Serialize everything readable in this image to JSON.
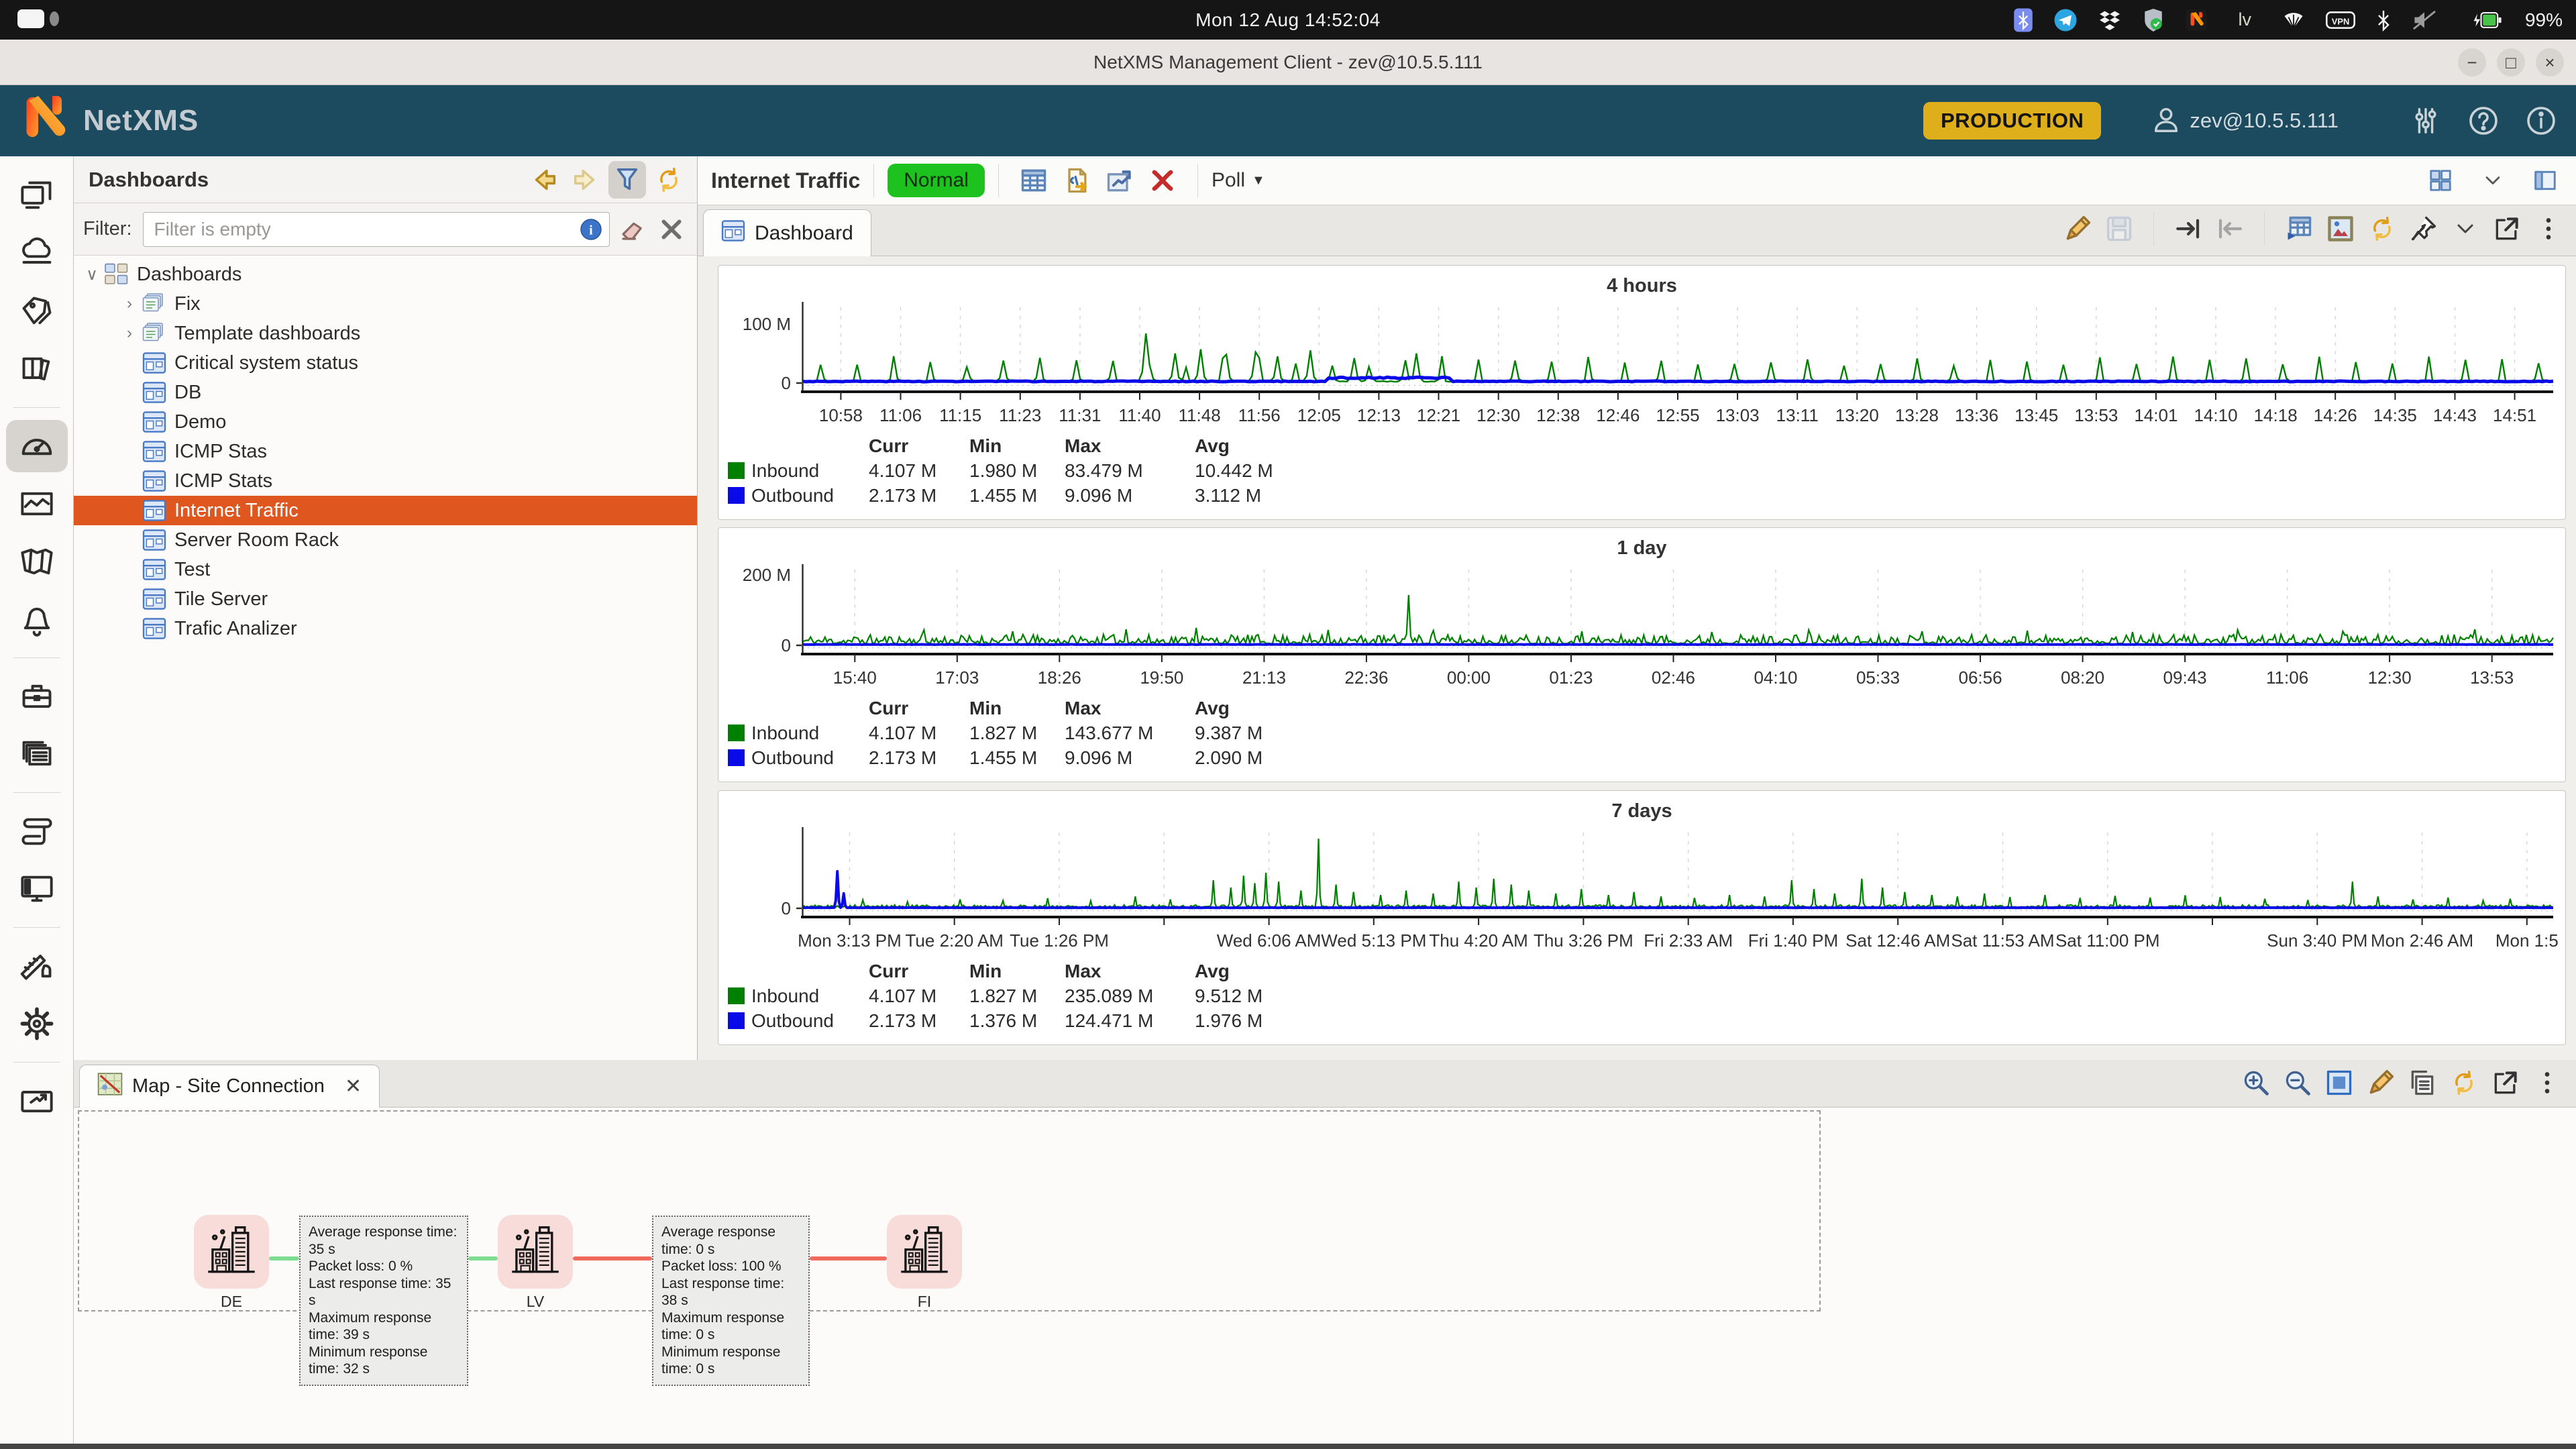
{
  "topbar": {
    "clock": "Mon 12 Aug 14:52:04",
    "keyboard_layout": "lv",
    "battery_pct": "99%",
    "tray_left_icons": [
      "bluetooth-app-icon",
      "telegram-icon",
      "dropbox-icon",
      "shield-check-icon",
      "netxms-tray-icon"
    ],
    "tray_right_icons": [
      "wifi-icon",
      "vpn-icon",
      "bluetooth-icon",
      "audio-muted-icon"
    ]
  },
  "window": {
    "title": "NetXMS Management Client - zev@10.5.5.111",
    "controls": [
      "minimize",
      "maximize",
      "close"
    ]
  },
  "header": {
    "brand": "NetXMS",
    "environment_badge": "PRODUCTION",
    "user": "zev@10.5.5.111"
  },
  "nav_strip": {
    "items": [
      {
        "name": "devices-icon"
      },
      {
        "name": "network-icon"
      },
      {
        "name": "tags-icon"
      },
      {
        "name": "logs-icon",
        "group_end": true
      },
      {
        "name": "dashboards-icon",
        "selected": true
      },
      {
        "name": "graphs-icon"
      },
      {
        "name": "maps-icon"
      },
      {
        "name": "alarms-icon",
        "group_end": true
      },
      {
        "name": "business-icon"
      },
      {
        "name": "objects-icon",
        "group_end": true
      },
      {
        "name": "scripts-icon"
      },
      {
        "name": "terminal-icon",
        "group_end": true
      },
      {
        "name": "tools-icon"
      },
      {
        "name": "settings-icon",
        "group_end": true
      },
      {
        "name": "license-icon"
      }
    ]
  },
  "sidebar": {
    "title": "Dashboards",
    "header_icons": [
      "back-icon",
      "forward-icon",
      "filter-funnel-icon",
      "refresh-icon"
    ],
    "filter_label": "Filter:",
    "filter_placeholder": "Filter is empty",
    "tree": [
      {
        "label": "Dashboards",
        "depth": 0,
        "icon": "dashboard-root-icon",
        "chevron": "expanded"
      },
      {
        "label": "Fix",
        "depth": 1,
        "icon": "dashboard-folder-icon",
        "chevron": "collapsed"
      },
      {
        "label": "Template dashboards",
        "depth": 1,
        "icon": "dashboard-folder-icon",
        "chevron": "collapsed"
      },
      {
        "label": "Critical system status",
        "depth": 1,
        "icon": "dashboard-icon"
      },
      {
        "label": "DB",
        "depth": 1,
        "icon": "dashboard-icon"
      },
      {
        "label": "Demo",
        "depth": 1,
        "icon": "dashboard-icon"
      },
      {
        "label": "ICMP Stas",
        "depth": 1,
        "icon": "dashboard-icon"
      },
      {
        "label": "ICMP Stats",
        "depth": 1,
        "icon": "dashboard-icon"
      },
      {
        "label": "Internet Traffic",
        "depth": 1,
        "icon": "dashboard-icon",
        "selected": true
      },
      {
        "label": "Server Room Rack",
        "depth": 1,
        "icon": "dashboard-icon"
      },
      {
        "label": "Test",
        "depth": 1,
        "icon": "dashboard-icon"
      },
      {
        "label": "Tile Server",
        "depth": 1,
        "icon": "dashboard-icon"
      },
      {
        "label": "Trafic Analizer",
        "depth": 1,
        "icon": "dashboard-icon"
      }
    ]
  },
  "main": {
    "title": "Internet Traffic",
    "status_badge": "Normal",
    "status_color": "#1ec21e",
    "toolbar_icons": [
      "table-icon",
      "export-icon",
      "chart-export-icon",
      "delete-icon"
    ],
    "poll_label": "Poll",
    "corner_icons": [
      "views-grid-icon",
      "chevron-down-icon",
      "layout-icon"
    ],
    "tab_label": "Dashboard",
    "tab_icon": "dashboard-icon",
    "tab_toolbar": [
      {
        "name": "edit-icon"
      },
      {
        "name": "save-icon",
        "disabled": true
      },
      {
        "sep": true
      },
      {
        "name": "jump-right-icon"
      },
      {
        "name": "jump-left-icon",
        "disabled": true
      },
      {
        "sep": true
      },
      {
        "name": "detach-table-icon"
      },
      {
        "name": "screenshot-icon"
      },
      {
        "name": "refresh-icon"
      },
      {
        "name": "pin-icon"
      },
      {
        "name": "chevron-down-icon"
      },
      {
        "name": "open-external-icon"
      },
      {
        "name": "kebab-icon"
      }
    ]
  },
  "chart_data": [
    {
      "type": "line",
      "title": "4 hours",
      "legend_position": "bottom-left",
      "grid": true,
      "ylim": [
        0,
        130
      ],
      "y_axis_labels": [
        {
          "value": 100,
          "text": "100 M"
        },
        {
          "value": 0,
          "text": "0"
        }
      ],
      "tick_start": 0.022,
      "tick_end": 0.978,
      "x_ticks": [
        "10:58",
        "11:06",
        "11:15",
        "11:23",
        "11:31",
        "11:40",
        "11:48",
        "11:56",
        "12:05",
        "12:13",
        "12:21",
        "12:30",
        "12:38",
        "12:46",
        "12:55",
        "13:03",
        "13:11",
        "13:20",
        "13:28",
        "13:36",
        "13:45",
        "13:53",
        "14:01",
        "14:10",
        "14:18",
        "14:26",
        "14:35",
        "14:43",
        "14:51"
      ],
      "stats_headers": [
        "Curr",
        "Min",
        "Max",
        "Avg"
      ],
      "series": [
        {
          "name": "Inbound",
          "color": "#008000",
          "stroke": 2.4,
          "stats": {
            "curr": "4.107 M",
            "min": "1.980 M",
            "max": "83.479 M",
            "avg": "10.442 M"
          },
          "profile": {
            "mode": "spikes",
            "n": 480,
            "seed": 7,
            "baseline": 2.5,
            "noise": 1.4,
            "spike_every": 10,
            "spike_min": 26,
            "spike_max": 46,
            "peaks": [
              {
                "frac": 0.196,
                "value": 83.5
              },
              {
                "frac": 0.212,
                "value": 50
              },
              {
                "frac": 0.227,
                "value": 57
              },
              {
                "frac": 0.243,
                "value": 48
              },
              {
                "frac": 0.258,
                "value": 52
              },
              {
                "frac": 0.272,
                "value": 45
              },
              {
                "frac": 0.29,
                "value": 55
              },
              {
                "frac": 0.315,
                "value": 42
              },
              {
                "frac": 0.35,
                "value": 50
              }
            ]
          }
        },
        {
          "name": "Outbound",
          "color": "#0a0ae8",
          "stroke": 5,
          "stats": {
            "curr": "2.173 M",
            "min": "1.455 M",
            "max": "9.096 M",
            "avg": "3.112 M"
          },
          "profile": {
            "mode": "flat",
            "n": 480,
            "seed": 3,
            "baseline": 2.8,
            "noise": 1.2,
            "bumps": [
              {
                "from": 0.3,
                "to": 0.37,
                "value": 8.8
              }
            ]
          }
        }
      ]
    },
    {
      "type": "line",
      "title": "1 day",
      "legend_position": "bottom-left",
      "grid": true,
      "ylim": [
        0,
        220
      ],
      "y_axis_labels": [
        {
          "value": 200,
          "text": "200 M"
        },
        {
          "value": 0,
          "text": "0"
        }
      ],
      "tick_start": 0.03,
      "tick_end": 0.965,
      "x_ticks": [
        "15:40",
        "17:03",
        "18:26",
        "19:50",
        "21:13",
        "22:36",
        "00:00",
        "01:23",
        "02:46",
        "04:10",
        "05:33",
        "06:56",
        "08:20",
        "09:43",
        "11:06",
        "12:30",
        "13:53"
      ],
      "stats_headers": [
        "Curr",
        "Min",
        "Max",
        "Avg"
      ],
      "series": [
        {
          "name": "Inbound",
          "color": "#008000",
          "stroke": 2.2,
          "stats": {
            "curr": "4.107 M",
            "min": "1.827 M",
            "max": "143.677 M",
            "avg": "9.387 M"
          },
          "profile": {
            "mode": "noise",
            "n": 850,
            "seed": 11,
            "baseline": 5,
            "spread": 26,
            "peaks": [
              {
                "frac": 0.346,
                "value": 143.7
              },
              {
                "frac": 0.07,
                "value": 44
              },
              {
                "frac": 0.12,
                "value": 40
              },
              {
                "frac": 0.185,
                "value": 46
              },
              {
                "frac": 0.225,
                "value": 50
              },
              {
                "frac": 0.3,
                "value": 44
              },
              {
                "frac": 0.36,
                "value": 42
              },
              {
                "frac": 0.445,
                "value": 40
              },
              {
                "frac": 0.52,
                "value": 38
              },
              {
                "frac": 0.575,
                "value": 44
              },
              {
                "frac": 0.64,
                "value": 40
              },
              {
                "frac": 0.7,
                "value": 42
              },
              {
                "frac": 0.76,
                "value": 38
              },
              {
                "frac": 0.82,
                "value": 44
              },
              {
                "frac": 0.88,
                "value": 40
              },
              {
                "frac": 0.955,
                "value": 46
              }
            ]
          }
        },
        {
          "name": "Outbound",
          "color": "#0a0ae8",
          "stroke": 4,
          "stats": {
            "curr": "2.173 M",
            "min": "1.455 M",
            "max": "9.096 M",
            "avg": "2.090 M"
          },
          "profile": {
            "mode": "flat",
            "n": 850,
            "seed": 4,
            "baseline": 2.4,
            "noise": 0.9
          }
        }
      ]
    },
    {
      "type": "line",
      "title": "7 days",
      "legend_position": "bottom-left",
      "grid": true,
      "ylim": [
        0,
        260
      ],
      "y_axis_labels": [
        {
          "value": 0,
          "text": "0"
        }
      ],
      "tick_start": 0.027,
      "tick_end": 0.985,
      "x_ticks": [
        "Mon 3:13 PM",
        "Tue 2:20 AM",
        "Tue 1:26 PM",
        "",
        "Wed 6:06 AM",
        "Wed 5:13 PM",
        "Thu 4:20 AM",
        "Thu 3:26 PM",
        "Fri 2:33 AM",
        "Fri 1:40 PM",
        "Sat 12:46 AM",
        "Sat 11:53 AM",
        "Sat 11:00 PM",
        "",
        "Sun 3:40 PM",
        "Mon 2:46 AM",
        "Mon 1:5"
      ],
      "stats_headers": [
        "Curr",
        "Min",
        "Max",
        "Avg"
      ],
      "series": [
        {
          "name": "Inbound",
          "color": "#008000",
          "stroke": 2.2,
          "stats": {
            "curr": "4.107 M",
            "min": "1.827 M",
            "max": "235.089 M",
            "avg": "9.512 M"
          },
          "profile": {
            "mode": "noise",
            "n": 1100,
            "seed": 5,
            "baseline": 3.5,
            "spread": 8,
            "peaks": [
              {
                "frac": 0.035,
                "value": 28
              },
              {
                "frac": 0.06,
                "value": 22
              },
              {
                "frac": 0.09,
                "value": 30
              },
              {
                "frac": 0.115,
                "value": 26
              },
              {
                "frac": 0.14,
                "value": 34
              },
              {
                "frac": 0.165,
                "value": 25
              },
              {
                "frac": 0.19,
                "value": 40
              },
              {
                "frac": 0.21,
                "value": 30
              },
              {
                "frac": 0.235,
                "value": 95
              },
              {
                "frac": 0.245,
                "value": 70
              },
              {
                "frac": 0.252,
                "value": 110
              },
              {
                "frac": 0.258,
                "value": 85
              },
              {
                "frac": 0.265,
                "value": 120
              },
              {
                "frac": 0.272,
                "value": 90
              },
              {
                "frac": 0.285,
                "value": 60
              },
              {
                "frac": 0.295,
                "value": 235
              },
              {
                "frac": 0.305,
                "value": 80
              },
              {
                "frac": 0.315,
                "value": 55
              },
              {
                "frac": 0.33,
                "value": 45
              },
              {
                "frac": 0.345,
                "value": 60
              },
              {
                "frac": 0.36,
                "value": 50
              },
              {
                "frac": 0.375,
                "value": 90
              },
              {
                "frac": 0.385,
                "value": 70
              },
              {
                "frac": 0.395,
                "value": 100
              },
              {
                "frac": 0.405,
                "value": 80
              },
              {
                "frac": 0.415,
                "value": 60
              },
              {
                "frac": 0.43,
                "value": 50
              },
              {
                "frac": 0.445,
                "value": 65
              },
              {
                "frac": 0.46,
                "value": 45
              },
              {
                "frac": 0.475,
                "value": 55
              },
              {
                "frac": 0.49,
                "value": 40
              },
              {
                "frac": 0.51,
                "value": 35
              },
              {
                "frac": 0.53,
                "value": 45
              },
              {
                "frac": 0.55,
                "value": 40
              },
              {
                "frac": 0.565,
                "value": 95
              },
              {
                "frac": 0.578,
                "value": 65
              },
              {
                "frac": 0.59,
                "value": 50
              },
              {
                "frac": 0.605,
                "value": 100
              },
              {
                "frac": 0.617,
                "value": 70
              },
              {
                "frac": 0.63,
                "value": 55
              },
              {
                "frac": 0.645,
                "value": 45
              },
              {
                "frac": 0.66,
                "value": 40
              },
              {
                "frac": 0.675,
                "value": 50
              },
              {
                "frac": 0.69,
                "value": 38
              },
              {
                "frac": 0.71,
                "value": 45
              },
              {
                "frac": 0.73,
                "value": 35
              },
              {
                "frac": 0.75,
                "value": 42
              },
              {
                "frac": 0.77,
                "value": 36
              },
              {
                "frac": 0.79,
                "value": 44
              },
              {
                "frac": 0.81,
                "value": 38
              },
              {
                "frac": 0.835,
                "value": 32
              },
              {
                "frac": 0.86,
                "value": 28
              },
              {
                "frac": 0.885,
                "value": 90
              },
              {
                "frac": 0.9,
                "value": 40
              },
              {
                "frac": 0.92,
                "value": 30
              },
              {
                "frac": 0.94,
                "value": 36
              },
              {
                "frac": 0.96,
                "value": 26
              },
              {
                "frac": 0.975,
                "value": 32
              }
            ]
          }
        },
        {
          "name": "Outbound",
          "color": "#0a0ae8",
          "stroke": 4,
          "stats": {
            "curr": "2.173 M",
            "min": "1.376 M",
            "max": "124.471 M",
            "avg": "1.976 M"
          },
          "profile": {
            "mode": "flat",
            "n": 1100,
            "seed": 9,
            "baseline": 2.0,
            "noise": 0.7,
            "peaks": [
              {
                "frac": 0.02,
                "value": 124.5
              },
              {
                "frac": 0.024,
                "value": 50
              }
            ]
          }
        }
      ]
    }
  ],
  "map": {
    "tab_label": "Map - Site Connection",
    "toolbar_icons": [
      "zoom-in-icon",
      "zoom-out-icon",
      "fit-window-icon",
      "edit-icon",
      "copy-icon",
      "refresh-icon",
      "open-external-icon",
      "kebab-icon"
    ],
    "nodes": [
      {
        "label": "DE"
      },
      {
        "label": "LV"
      },
      {
        "label": "FI"
      }
    ],
    "links": [
      {
        "status_color": "#7ddc8f",
        "metrics": [
          "Average response time: 35 s",
          "Packet loss: 0 %",
          "Last response time: 35 s",
          "Maximum response time: 39 s",
          "Minimum response time: 32 s"
        ]
      },
      {
        "status_color": "#ef6a5a",
        "metrics": [
          "Average response time: 0 s",
          "Packet loss: 100 %",
          "Last response time: 38 s",
          "Maximum response time: 0 s",
          "Minimum response time: 0 s"
        ]
      }
    ]
  }
}
